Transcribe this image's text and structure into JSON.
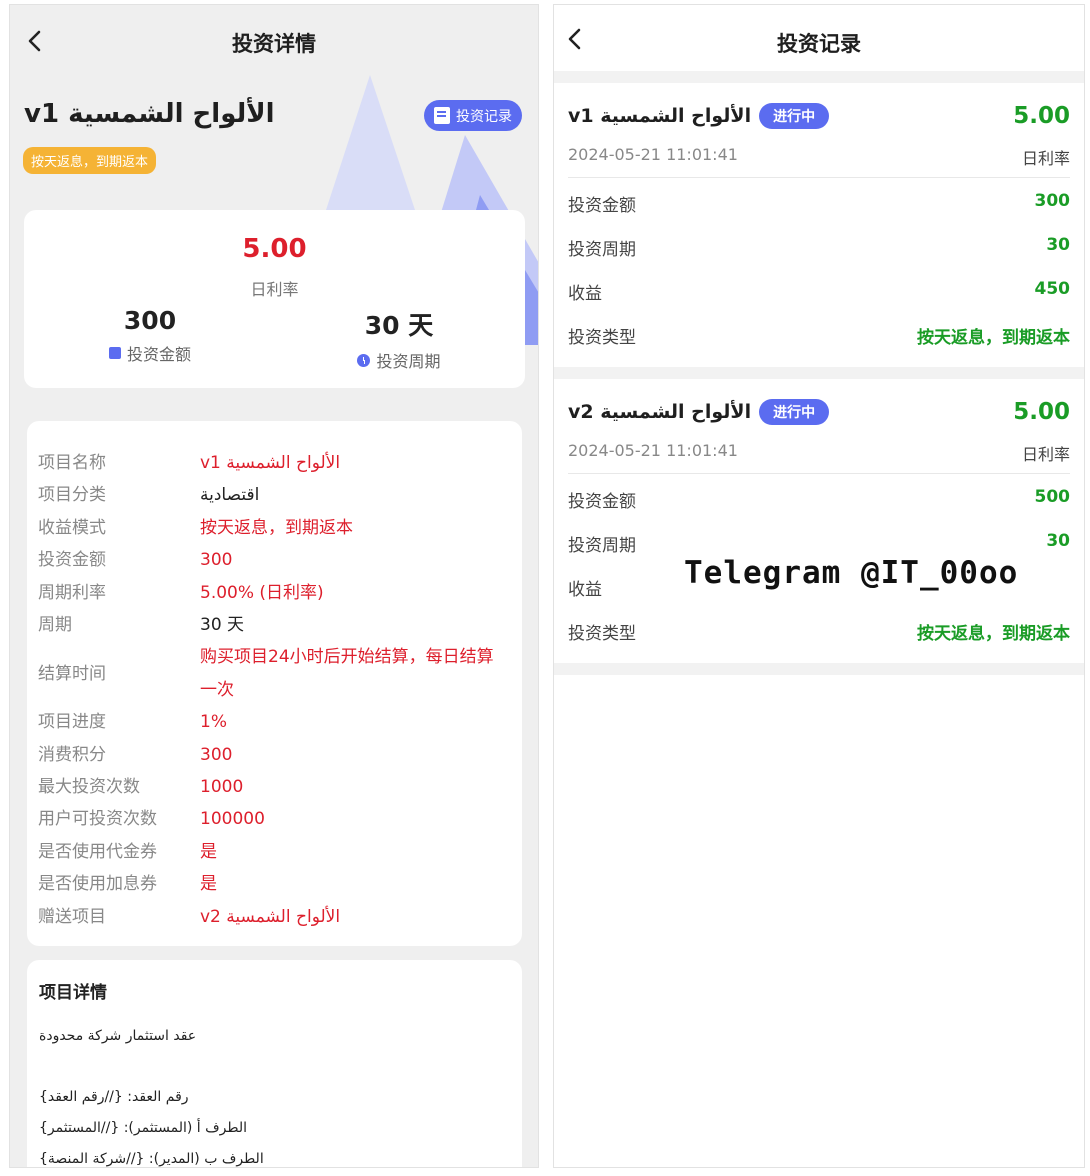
{
  "left": {
    "header_title": "投资详情",
    "product_name": "v1 الألواح الشمسية",
    "tag": "按天返息，到期返本",
    "record_button": "投资记录",
    "rate": "5.00",
    "rate_label": "日利率",
    "amount": "300",
    "amount_label": "投资金额",
    "period": "30 天",
    "period_label": "投资周期",
    "info": [
      {
        "k": "项目名称",
        "v": "v1 الألواح الشمسية"
      },
      {
        "k": "项目分类",
        "v": "اقتصادية"
      },
      {
        "k": "收益模式",
        "v": "按天返息，到期返本"
      },
      {
        "k": "投资金额",
        "v": "300"
      },
      {
        "k": "周期利率",
        "v": "5.00% (日利率)"
      },
      {
        "k": "周期",
        "v": "30 天"
      },
      {
        "k": "结算时间",
        "v": "购买项目24小时后开始结算，每日结算一次"
      },
      {
        "k": "项目进度",
        "v": "1%"
      },
      {
        "k": "消费积分",
        "v": "300"
      },
      {
        "k": "最大投资次数",
        "v": "1000"
      },
      {
        "k": "用户可投资次数",
        "v": "100000"
      },
      {
        "k": "是否使用代金券",
        "v": "是"
      },
      {
        "k": "是否使用加息券",
        "v": "是"
      },
      {
        "k": "赠送项目",
        "v": "v2 الألواح الشمسية"
      }
    ],
    "detail_title": "项目详情",
    "detail_lines": [
      "عقد استثمار شركة محدودة",
      "رقم العقد: {//رقم العقد}",
      "الطرف أ (المستثمر): {//المستثمر}",
      "الطرف ب (المدير): {//شركة المنصة}"
    ]
  },
  "right": {
    "header_title": "投资记录",
    "records": [
      {
        "name": "v1 الألواح الشمسية",
        "status": "进行中",
        "rate": "5.00",
        "time": "2024-05-21 11:01:41",
        "rate_label": "日利率",
        "rows": [
          {
            "k": "投资金额",
            "v": "300"
          },
          {
            "k": "投资周期",
            "v": "30"
          },
          {
            "k": "收益",
            "v": "450"
          },
          {
            "k": "投资类型",
            "v": "按天返息，到期返本"
          }
        ]
      },
      {
        "name": "v2 الألواح الشمسية",
        "status": "进行中",
        "rate": "5.00",
        "time": "2024-05-21 11:01:41",
        "rate_label": "日利率",
        "rows": [
          {
            "k": "投资金额",
            "v": "500"
          },
          {
            "k": "投资周期",
            "v": "30"
          },
          {
            "k": "收益",
            "v": ""
          },
          {
            "k": "投资类型",
            "v": "按天返息，到期返本"
          }
        ]
      }
    ],
    "watermark": "Telegram @IT_00oo"
  },
  "colors": {
    "accent": "#5b6cf0",
    "red": "#dd1f2c",
    "green": "#1a9c26",
    "orange": "#f5b335"
  }
}
